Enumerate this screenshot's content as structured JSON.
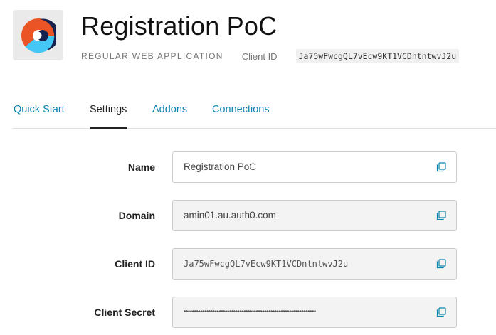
{
  "header": {
    "title": "Registration PoC",
    "app_type": "REGULAR WEB APPLICATION",
    "client_id_label": "Client ID",
    "client_id_value": "Ja75wFwcgQL7vEcw9KT1VCDntntwvJ2u",
    "logo_icon": "auth0-app-logo-icon",
    "logo_colors": {
      "orange": "#eb5424",
      "navy": "#16214d",
      "blue": "#44c7f4",
      "tile": "#eaeaea"
    }
  },
  "tabs": [
    {
      "label": "Quick Start",
      "active": false
    },
    {
      "label": "Settings",
      "active": true
    },
    {
      "label": "Addons",
      "active": false
    },
    {
      "label": "Connections",
      "active": false
    }
  ],
  "colors": {
    "link": "#0a84ae",
    "text": "#222222",
    "field_readonly_bg": "#f3f3f3",
    "border": "#cccccc"
  },
  "fields": {
    "name": {
      "label": "Name",
      "value": "Registration PoC",
      "copy_icon": "copy-icon"
    },
    "domain": {
      "label": "Domain",
      "value": "amin01.au.auth0.com",
      "copy_icon": "copy-icon"
    },
    "client_id": {
      "label": "Client ID",
      "value": "Ja75wFwcgQL7vEcw9KT1VCDntntwvJ2u",
      "copy_icon": "copy-icon"
    },
    "client_secret": {
      "label": "Client Secret",
      "value": "••••••••••••••••••••••••••••••••••••••••••••••••••••••••••••••••",
      "copy_icon": "copy-icon"
    }
  }
}
